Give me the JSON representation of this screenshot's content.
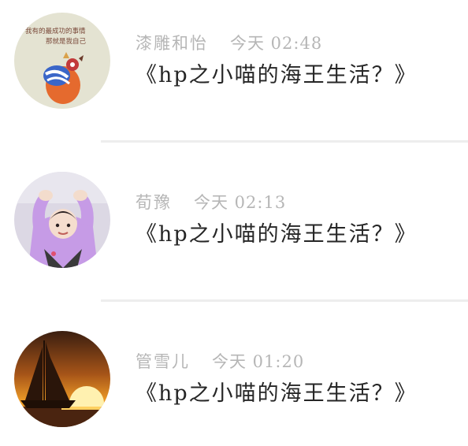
{
  "feed": {
    "items": [
      {
        "author": "漆雕和怡",
        "time": "今天 02:48",
        "title": "《hp之小喵的海王生活？》",
        "avatar_text_line1": "我有的最成功的事情",
        "avatar_text_line2": "那就是我自己"
      },
      {
        "author": "荀豫",
        "time": "今天 02:13",
        "title": "《hp之小喵的海王生活？》"
      },
      {
        "author": "管雪儿",
        "time": "今天 01:20",
        "title": "《hp之小喵的海王生活？》"
      }
    ]
  },
  "colors": {
    "meta_text": "#b6b6b6",
    "title_text": "#262626",
    "divider": "#ededed"
  }
}
